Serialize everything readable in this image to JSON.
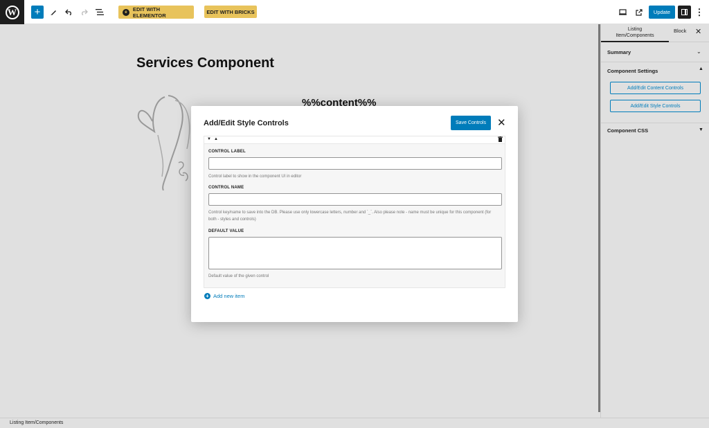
{
  "toolbar": {
    "inserter_icon": "plus-icon",
    "elementor_label": "EDIT WITH ELEMENTOR",
    "bricks_label": "EDIT WITH BRICKS",
    "update_label": "Update"
  },
  "canvas": {
    "title": "Services Component",
    "content_token": "%%content%%"
  },
  "sidebar": {
    "tab_listing": [
      "Listing",
      "Item/Components"
    ],
    "tab_block": "Block",
    "summary": "Summary",
    "component_settings": "Component Settings",
    "content_controls_btn": "Add/Edit Content Controls",
    "style_controls_btn": "Add/Edit Style Controls",
    "component_css": "Component CSS"
  },
  "modal": {
    "title": "Add/Edit Style Controls",
    "save_label": "Save Controls",
    "fields": {
      "control_label": {
        "label": "CONTROL LABEL",
        "value": "",
        "help": "Control label to show in the component UI in editor"
      },
      "control_name": {
        "label": "CONTROL NAME",
        "value": "",
        "help": "Control key/name to save into the DB. Please use only lowercase letters, number and `_`. Also please note - name must be unique for this component (for both - styles and controls)"
      },
      "default_value": {
        "label": "DEFAULT VALUE",
        "value": "",
        "help": "Default value of the given control"
      }
    },
    "add_item_label": "Add new item"
  },
  "footer": {
    "breadcrumb": "Listing Item/Components"
  },
  "colors": {
    "accent": "#007cba",
    "plugin_button": "#e8c35b",
    "dark": "#1e1e1e"
  }
}
